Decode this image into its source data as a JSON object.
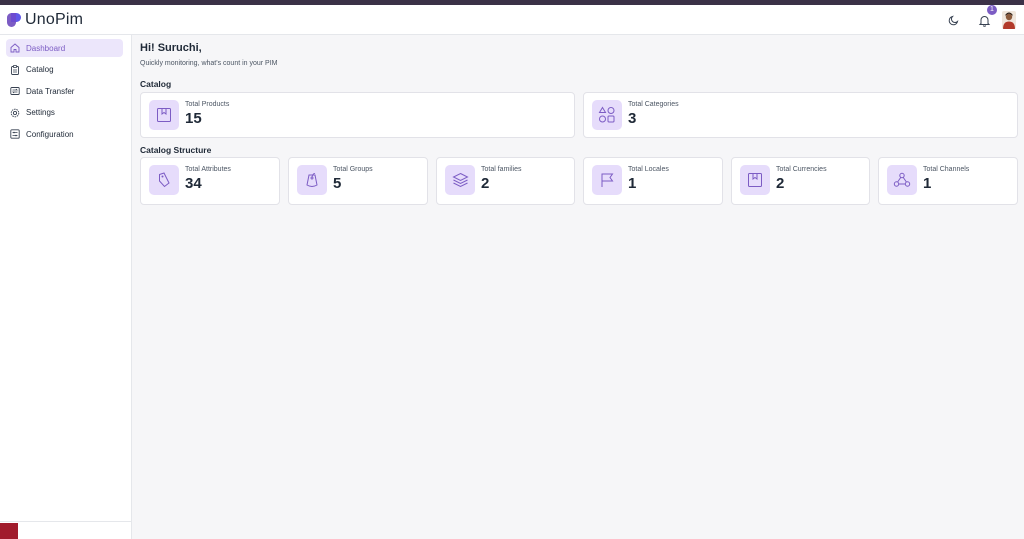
{
  "app": {
    "name": "UnoPim"
  },
  "header": {
    "notification_count": "1"
  },
  "sidebar": {
    "items": [
      {
        "label": "Dashboard",
        "icon": "home-icon"
      },
      {
        "label": "Catalog",
        "icon": "clipboard-icon"
      },
      {
        "label": "Data Transfer",
        "icon": "transfer-icon"
      },
      {
        "label": "Settings",
        "icon": "gear-icon"
      },
      {
        "label": "Configuration",
        "icon": "sliders-icon"
      }
    ]
  },
  "main": {
    "greeting": "Hi! Suruchi,",
    "subtitle": "Quickly monitoring, what's count in your PIM",
    "catalog": {
      "title": "Catalog",
      "cards": [
        {
          "label": "Total Products",
          "value": "15",
          "icon": "bookmark-box-icon"
        },
        {
          "label": "Total Categories",
          "value": "3",
          "icon": "shapes-icon"
        }
      ]
    },
    "structure": {
      "title": "Catalog Structure",
      "cards": [
        {
          "label": "Total Attributes",
          "value": "34",
          "icon": "tag-icon"
        },
        {
          "label": "Total Groups",
          "value": "5",
          "icon": "tag-icon"
        },
        {
          "label": "Total families",
          "value": "2",
          "icon": "layers-icon"
        },
        {
          "label": "Total Locales",
          "value": "1",
          "icon": "flag-icon"
        },
        {
          "label": "Total Currencies",
          "value": "2",
          "icon": "bookmark-box-icon"
        },
        {
          "label": "Total Channels",
          "value": "1",
          "icon": "network-icon"
        }
      ]
    }
  },
  "colors": {
    "accent": "#7c5cc4",
    "accent_light": "#e6dcfb"
  }
}
